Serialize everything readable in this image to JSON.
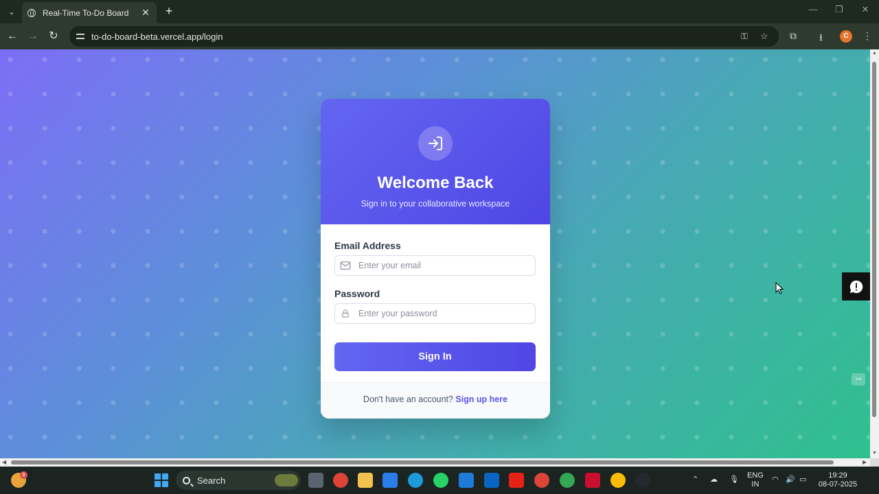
{
  "browser": {
    "tab_title": "Real-Time To-Do Board",
    "url": "to-do-board-beta.vercel.app/login",
    "profile_initial": "C"
  },
  "login": {
    "title": "Welcome Back",
    "subtitle": "Sign in to your collaborative workspace",
    "email_label": "Email Address",
    "email_placeholder": "Enter your email",
    "password_label": "Password",
    "password_placeholder": "Enter your password",
    "signin_label": "Sign In",
    "footer_text": "Don't have an account?",
    "signup_link": "Sign up here"
  },
  "taskbar": {
    "search_label": "Search",
    "weather_badge": "9",
    "language": "ENG",
    "region": "IN",
    "time": "19:29",
    "date": "08-07-2025"
  },
  "colors": {
    "accent": "#4f46e5",
    "gradient_start": "#7c6ef6",
    "gradient_end": "#2fc08e"
  }
}
